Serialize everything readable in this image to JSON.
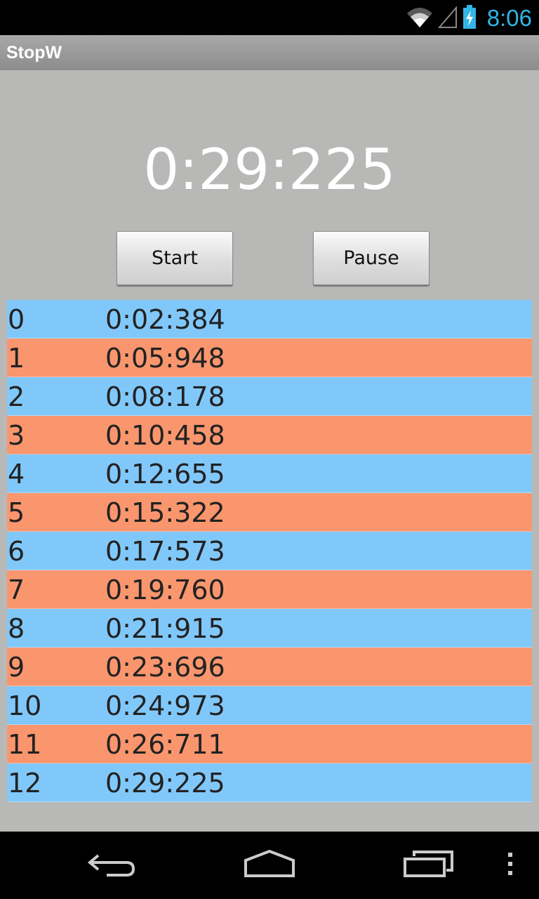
{
  "status_bar": {
    "time": "8:06",
    "icons": [
      "wifi-icon",
      "cell-signal-icon",
      "battery-charging-icon"
    ],
    "accent_color": "#33b5e5"
  },
  "app": {
    "title": "StopW"
  },
  "stopwatch": {
    "display": "0:29:225",
    "start_label": "Start",
    "pause_label": "Pause"
  },
  "laps": [
    {
      "index": "0",
      "time": "0:02:384"
    },
    {
      "index": "1",
      "time": "0:05:948"
    },
    {
      "index": "2",
      "time": "0:08:178"
    },
    {
      "index": "3",
      "time": "0:10:458"
    },
    {
      "index": "4",
      "time": "0:12:655"
    },
    {
      "index": "5",
      "time": "0:15:322"
    },
    {
      "index": "6",
      "time": "0:17:573"
    },
    {
      "index": "7",
      "time": "0:19:760"
    },
    {
      "index": "8",
      "time": "0:21:915"
    },
    {
      "index": "9",
      "time": "0:23:696"
    },
    {
      "index": "10",
      "time": "0:24:973"
    },
    {
      "index": "11",
      "time": "0:26:711"
    },
    {
      "index": "12",
      "time": "0:29:225"
    }
  ],
  "colors": {
    "row_even": "#81c8fa",
    "row_odd": "#f9966e",
    "background": "#b8b8b7"
  },
  "nav_bar": {
    "icons": [
      "back-icon",
      "home-icon",
      "recent-apps-icon",
      "overflow-menu-icon"
    ]
  }
}
